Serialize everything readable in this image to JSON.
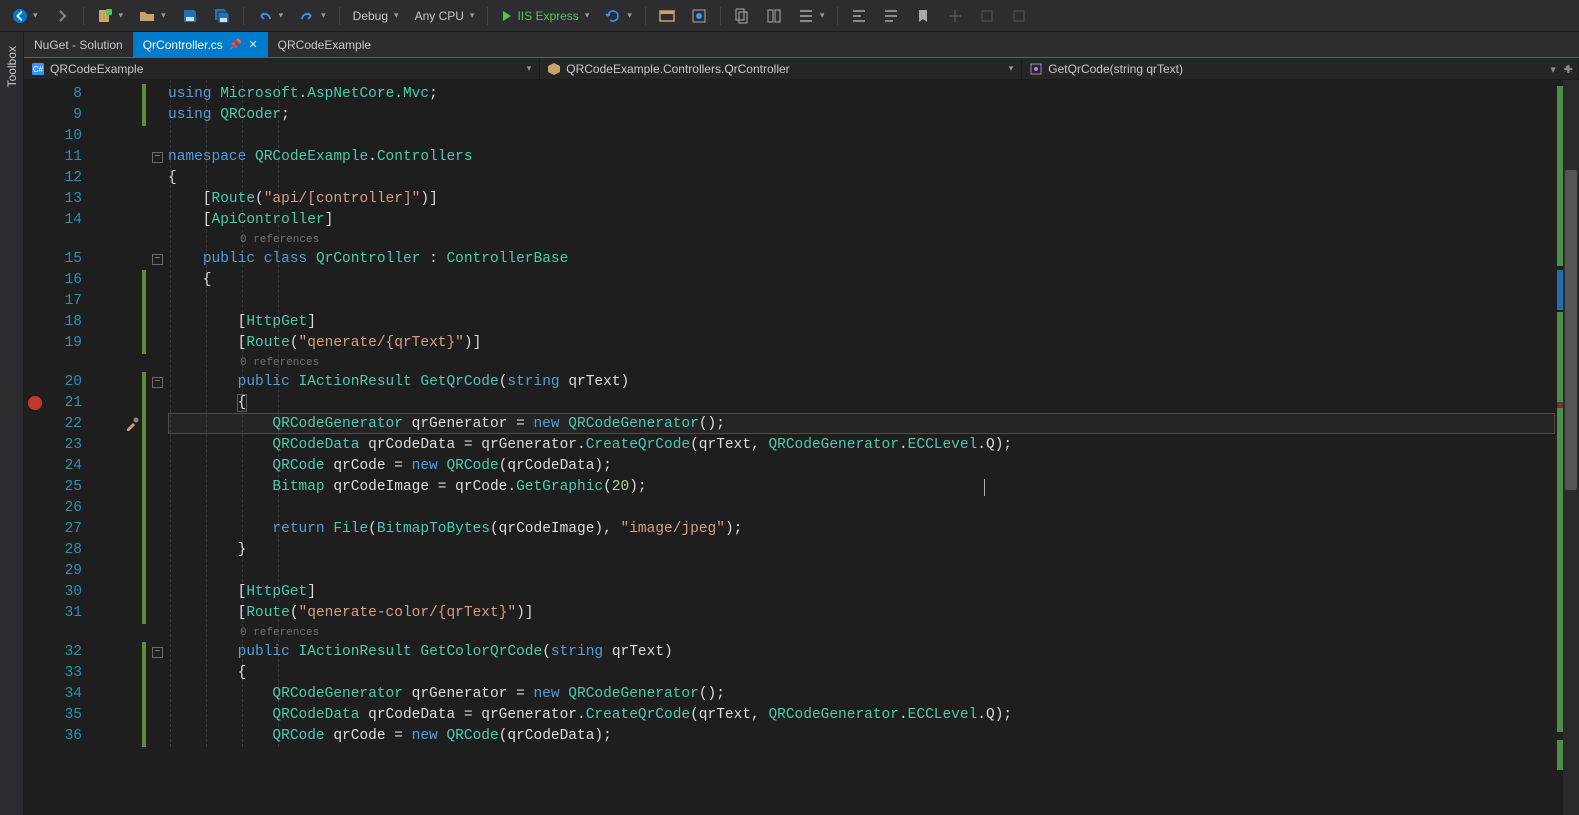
{
  "toolbar": {
    "config": "Debug",
    "platform": "Any CPU",
    "run_label": "IIS Express"
  },
  "dock": {
    "toolbox": "Toolbox"
  },
  "tabs": [
    {
      "label": "NuGet - Solution",
      "active": false
    },
    {
      "label": "QrController.cs",
      "active": true
    },
    {
      "label": "QRCodeExample",
      "active": false
    }
  ],
  "nav": {
    "project": "QRCodeExample",
    "class": "QRCodeExample.Controllers.QrController",
    "member": "GetQrCode(string qrText)"
  },
  "codelens": "0 references",
  "breakpoint_line": 21,
  "current_line": 22,
  "code_lines": [
    {
      "n": 8,
      "raw": "using Microsoft.AspNetCore.Mvc;",
      "i": 0
    },
    {
      "n": 9,
      "raw": "using QRCoder;",
      "i": 0
    },
    {
      "n": 10,
      "raw": "",
      "i": 0
    },
    {
      "n": 11,
      "raw": "namespace QRCodeExample.Controllers",
      "i": 0,
      "fold": true
    },
    {
      "n": 12,
      "raw": "{",
      "i": 0
    },
    {
      "n": 13,
      "raw": "[Route(\"api/[controller]\")]",
      "i": 1
    },
    {
      "n": 14,
      "raw": "[ApiController]",
      "i": 1
    },
    {
      "lens": true
    },
    {
      "n": 15,
      "raw": "public class QrController : ControllerBase",
      "i": 1,
      "fold": true
    },
    {
      "n": 16,
      "raw": "{",
      "i": 1
    },
    {
      "n": 17,
      "raw": "",
      "i": 1
    },
    {
      "n": 18,
      "raw": "[HttpGet]",
      "i": 2
    },
    {
      "n": 19,
      "raw": "[Route(\"qenerate/{qrText}\")]",
      "i": 2
    },
    {
      "lens": true
    },
    {
      "n": 20,
      "raw": "public IActionResult GetQrCode(string qrText)",
      "i": 2,
      "fold": true
    },
    {
      "n": 21,
      "raw": "{",
      "i": 2,
      "box": true
    },
    {
      "n": 22,
      "raw": "QRCodeGenerator qrGenerator = new QRCodeGenerator();",
      "i": 3
    },
    {
      "n": 23,
      "raw": "QRCodeData qrCodeData = qrGenerator.CreateQrCode(qrText, QRCodeGenerator.ECCLevel.Q);",
      "i": 3
    },
    {
      "n": 24,
      "raw": "QRCode qrCode = new QRCode(qrCodeData);",
      "i": 3
    },
    {
      "n": 25,
      "raw": "Bitmap qrCodeImage = qrCode.GetGraphic(20);",
      "i": 3
    },
    {
      "n": 26,
      "raw": "",
      "i": 3
    },
    {
      "n": 27,
      "raw": "return File(BitmapToBytes(qrCodeImage), \"image/jpeg\");",
      "i": 3
    },
    {
      "n": 28,
      "raw": "}",
      "i": 2
    },
    {
      "n": 29,
      "raw": "",
      "i": 1
    },
    {
      "n": 30,
      "raw": "[HttpGet]",
      "i": 2
    },
    {
      "n": 31,
      "raw": "[Route(\"qenerate-color/{qrText}\")]",
      "i": 2
    },
    {
      "lens": true
    },
    {
      "n": 32,
      "raw": "public IActionResult GetColorQrCode(string qrText)",
      "i": 2,
      "fold": true
    },
    {
      "n": 33,
      "raw": "{",
      "i": 2
    },
    {
      "n": 34,
      "raw": "QRCodeGenerator qrGenerator = new QRCodeGenerator();",
      "i": 3
    },
    {
      "n": 35,
      "raw": "QRCodeData qrCodeData = qrGenerator.CreateQrCode(qrText, QRCodeGenerator.ECCLevel.Q);",
      "i": 3
    },
    {
      "n": 36,
      "raw": "QRCode qrCode = new QRCode(qrCodeData);",
      "i": 3
    }
  ]
}
